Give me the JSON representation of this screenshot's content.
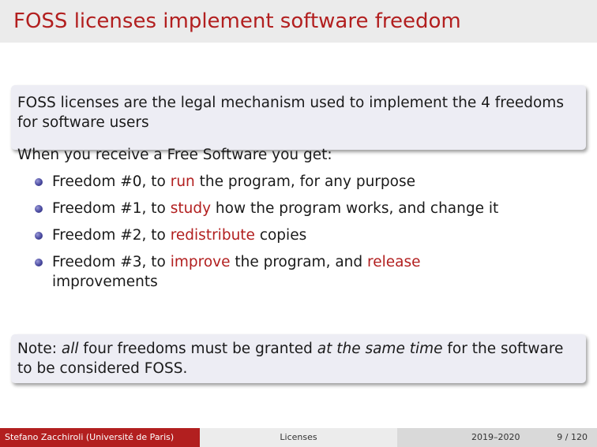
{
  "slide": {
    "title": "FOSS licenses implement software freedom",
    "block1": "FOSS licenses are the legal mechanism used to implement the 4 freedoms for software users",
    "intro": "When you receive a Free Software you get:",
    "freedoms": [
      {
        "pre": "Freedom #0, to ",
        "hl": "run",
        "post": " the program, for any purpose"
      },
      {
        "pre": "Freedom #1, to ",
        "hl": "study",
        "post": " how the program works, and change it"
      },
      {
        "pre": "Freedom #2, to ",
        "hl": "redistribute",
        "post": " copies"
      },
      {
        "pre": "Freedom #3, to ",
        "hl": "improve",
        "mid": " the program, and ",
        "hl2": "release",
        "post": " improvements"
      }
    ],
    "note": {
      "p1": "Note: ",
      "em1": "all",
      "p2": " four freedoms must be granted ",
      "em2": "at the same time",
      "p3": " for the software to be considered FOSS."
    }
  },
  "footer": {
    "author": "Stefano Zacchiroli  (Université de Paris)",
    "topic": "Licenses",
    "date": "2019–2020",
    "page": "9 / 120"
  },
  "colors": {
    "accent": "#b21f1f",
    "block_bg": "#ededf4",
    "bullet": "#4a4aa0"
  }
}
